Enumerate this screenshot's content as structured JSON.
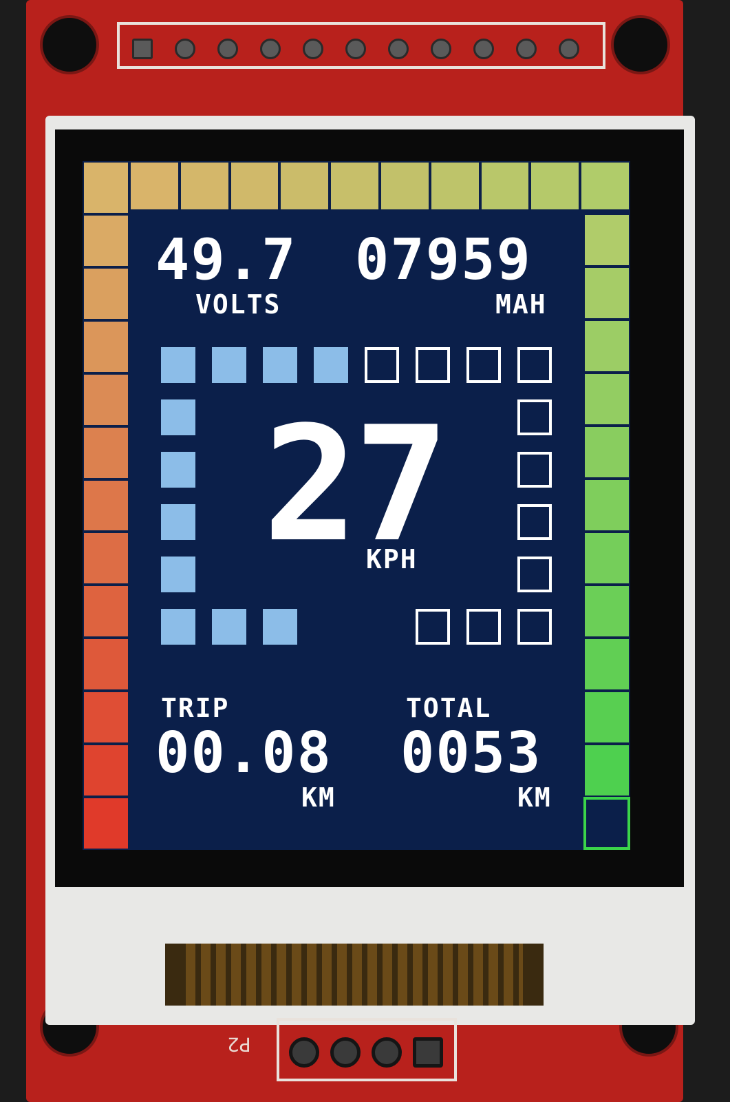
{
  "display": {
    "voltage": "49.7",
    "voltage_unit": "VOLTS",
    "capacity": "07959",
    "capacity_unit": "MAH",
    "speed": "27",
    "speed_unit": "KPH",
    "trip_label": "TRIP",
    "trip_value": "00.08",
    "trip_unit": "KM",
    "total_label": "TOTAL",
    "total_value": "0053",
    "total_unit": "KM",
    "speed_ring_filled_fraction": 0.5,
    "battery_bar_filled_fraction": 0.9
  },
  "board": {
    "connector_label": "P2"
  },
  "colors": {
    "screen_background": "#0b1f4a",
    "ring_filled": "#8cbde8",
    "ring_empty_outline": "#ffffff",
    "text": "#ffffff",
    "left_bar_top": "#d9b46a",
    "left_bar_bottom": "#e03a2a",
    "right_bar_top": "#b0cc6a",
    "right_bar_bottom": "#44d04c",
    "pcb": "#b8211c"
  }
}
